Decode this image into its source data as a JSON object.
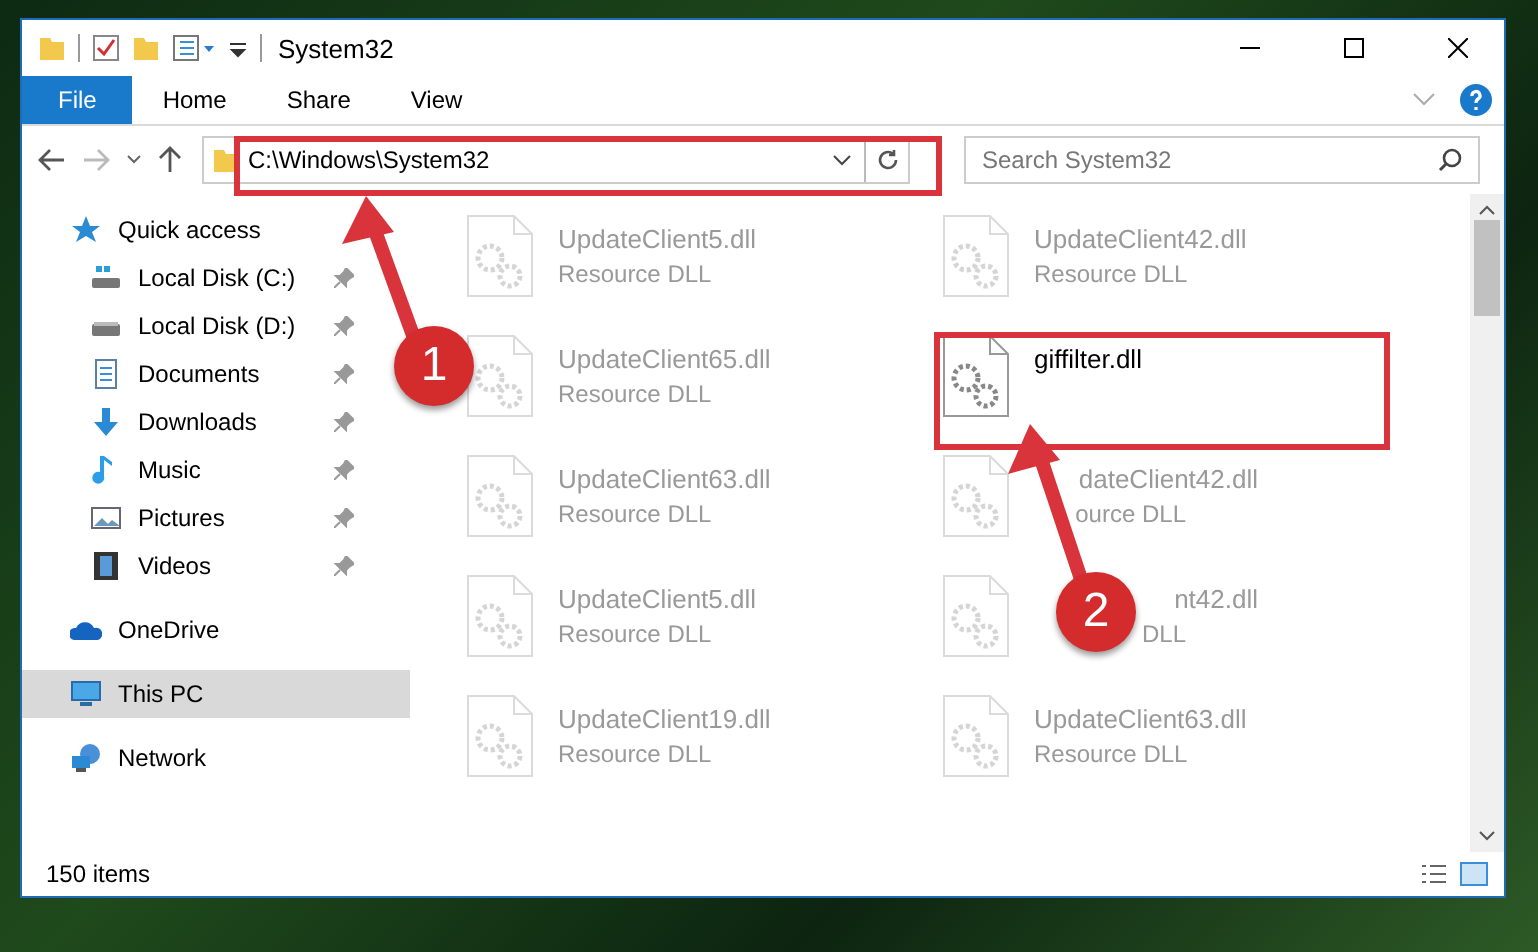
{
  "window": {
    "title": "System32"
  },
  "ribbon_tabs": [
    {
      "label": "File",
      "selected": true
    },
    {
      "label": "Home",
      "selected": false
    },
    {
      "label": "Share",
      "selected": false
    },
    {
      "label": "View",
      "selected": false
    }
  ],
  "address": {
    "value": "C:\\Windows\\System32"
  },
  "search": {
    "placeholder": "Search System32"
  },
  "nav": [
    {
      "label": "Quick access",
      "kind": "star",
      "selected": false,
      "children": [
        {
          "label": "Local Disk (C:)",
          "kind": "drive-c",
          "pinned": true
        },
        {
          "label": "Local Disk (D:)",
          "kind": "drive",
          "pinned": true
        },
        {
          "label": "Documents",
          "kind": "documents",
          "pinned": true
        },
        {
          "label": "Downloads",
          "kind": "downloads",
          "pinned": true
        },
        {
          "label": "Music",
          "kind": "music",
          "pinned": true
        },
        {
          "label": "Pictures",
          "kind": "pictures",
          "pinned": true
        },
        {
          "label": "Videos",
          "kind": "videos",
          "pinned": true
        }
      ]
    },
    {
      "label": "OneDrive",
      "kind": "cloud",
      "selected": false
    },
    {
      "label": "This PC",
      "kind": "pc",
      "selected": true
    },
    {
      "label": "Network",
      "kind": "network",
      "selected": false
    }
  ],
  "files": [
    {
      "name": "UpdateClient5.dll",
      "type": "Resource DLL",
      "blurred": true,
      "covered": false
    },
    {
      "name": "UpdateClient42.dll",
      "type": "Resource DLL",
      "blurred": true,
      "covered": false
    },
    {
      "name": "UpdateClient65.dll",
      "type": "Resource DLL",
      "blurred": true,
      "covered": false
    },
    {
      "name": "giffilter.dll",
      "blurred": false,
      "covered": false
    },
    {
      "name": "UpdateClient63.dll",
      "type": "Resource DLL",
      "blurred": true,
      "covered": false
    },
    {
      "name": "dateClient42.dll",
      "type": "ource DLL",
      "blurred": true,
      "covered": true
    },
    {
      "name": "UpdateClient5.dll",
      "type": "Resource DLL",
      "blurred": true,
      "covered": false
    },
    {
      "name": "nt42.dll",
      "type": "DLL",
      "blurred": true,
      "covered": true
    },
    {
      "name": "UpdateClient19.dll",
      "type": "Resource DLL",
      "blurred": true,
      "covered": false
    },
    {
      "name": "UpdateClient63.dll",
      "type": "Resource DLL",
      "blurred": true,
      "covered": false
    }
  ],
  "status_bar": {
    "count": "150 items"
  },
  "callouts": [
    {
      "number": "1"
    },
    {
      "number": "2"
    }
  ]
}
